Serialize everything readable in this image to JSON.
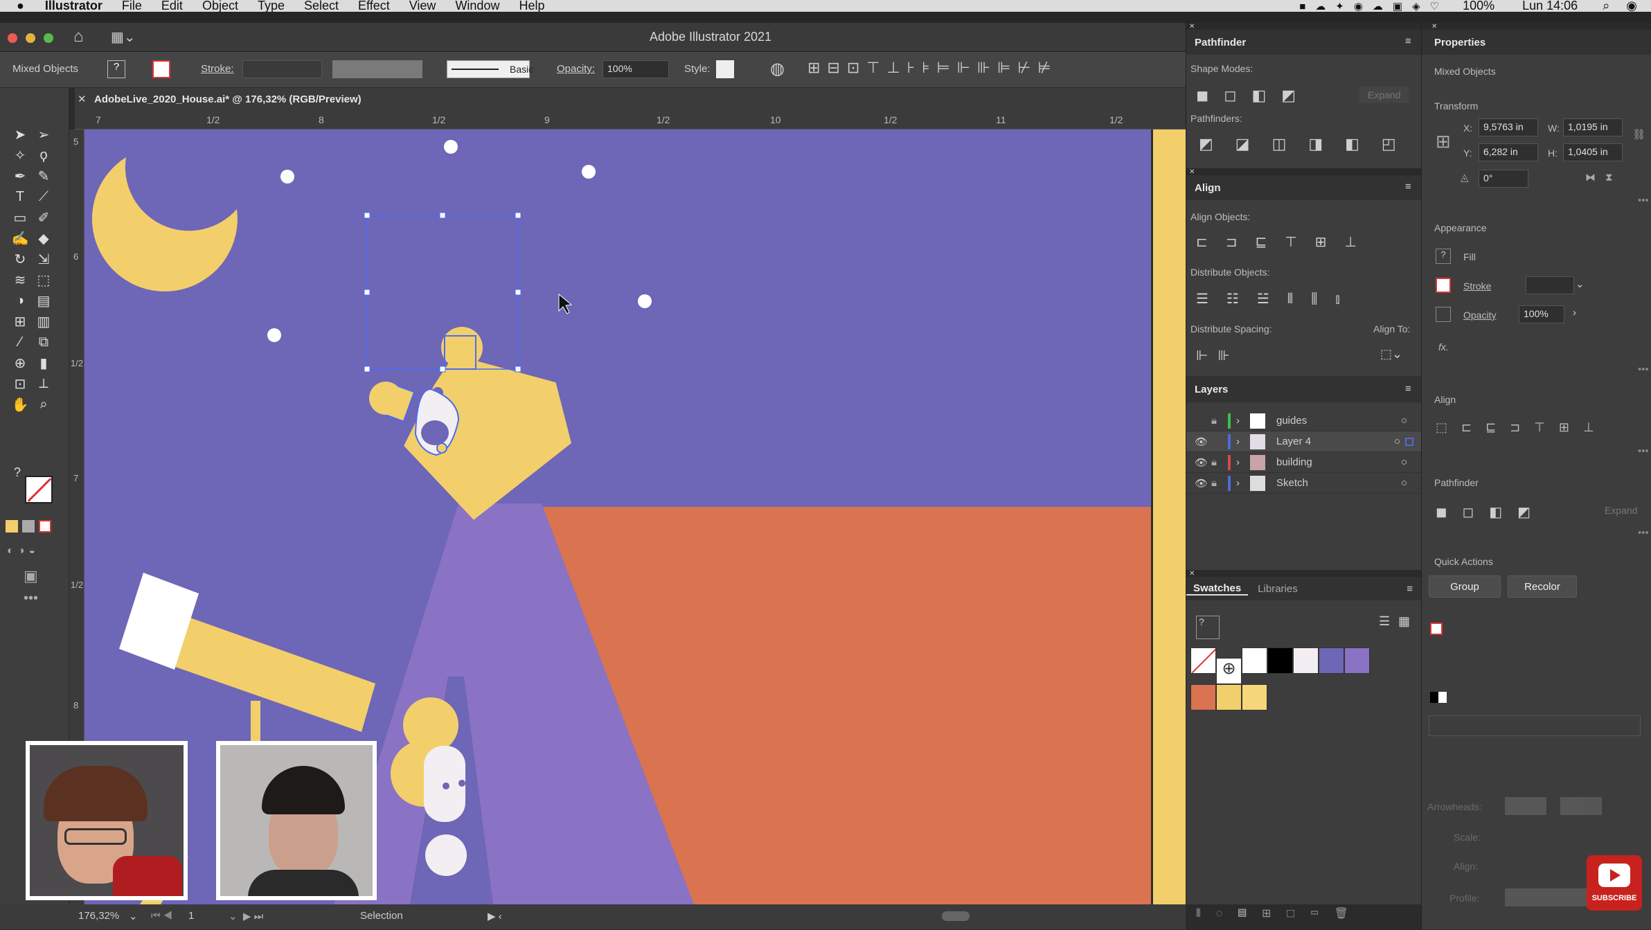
{
  "macos_menu": {
    "app_name": "Illustrator",
    "items": [
      "File",
      "Edit",
      "Object",
      "Type",
      "Select",
      "Effect",
      "View",
      "Window",
      "Help"
    ],
    "battery": "100%",
    "clock": "Lun 14:06"
  },
  "window": {
    "title": "Adobe Illustrator 2021"
  },
  "control_bar": {
    "selection_label": "Mixed Objects",
    "stroke_label": "Stroke:",
    "brush_label": "Basic",
    "opacity_label": "Opacity:",
    "opacity_value": "100%",
    "style_label": "Style:"
  },
  "document_tab": {
    "label": "AdobeLive_2020_House.ai* @ 176,32% (RGB/Preview)"
  },
  "rulers": {
    "h_ticks": [
      "7",
      "1/2",
      "8",
      "1/2",
      "9",
      "1/2",
      "10",
      "1/2",
      "11",
      "1/2"
    ],
    "v_ticks": [
      "5",
      "6",
      "1/2",
      "7",
      "1/2",
      "8"
    ]
  },
  "status_bar": {
    "zoom": "176,32%",
    "artboard": "1",
    "tool": "Selection"
  },
  "pathfinder_panel": {
    "title": "Pathfinder",
    "shape_modes": "Shape Modes:",
    "expand": "Expand",
    "pathfinders": "Pathfinders:"
  },
  "align_panel": {
    "title": "Align",
    "align_objects": "Align Objects:",
    "distribute_objects": "Distribute Objects:",
    "distribute_spacing": "Distribute Spacing:",
    "align_to": "Align To:"
  },
  "layers_panel": {
    "title": "Layers",
    "layers": [
      {
        "name": "guides",
        "color": "#3fbf4f",
        "visible": false,
        "locked": true
      },
      {
        "name": "Layer 4",
        "color": "#4b6bd8",
        "visible": true,
        "locked": false
      },
      {
        "name": "building",
        "color": "#d94848",
        "visible": true,
        "locked": true
      },
      {
        "name": "Sketch",
        "color": "#4b6bd8",
        "visible": true,
        "locked": true
      }
    ]
  },
  "swatches_panel": {
    "tab_swatches": "Swatches",
    "tab_libraries": "Libraries",
    "colors": [
      "none",
      "registration",
      "#ffffff",
      "#000000",
      "#f3eef2",
      "#6e66b6",
      "#8a72c4",
      "#d97350",
      "#f2cf6b",
      "#f5d67a"
    ]
  },
  "properties_panel": {
    "title": "Properties",
    "selection": "Mixed Objects",
    "transform_label": "Transform",
    "x_label": "X:",
    "x_value": "9,5763 in",
    "y_label": "Y:",
    "y_value": "6,282 in",
    "w_label": "W:",
    "w_value": "1,0195 in",
    "h_label": "H:",
    "h_value": "1,0405 in",
    "angle_value": "0°",
    "appearance_label": "Appearance",
    "fill_label": "Fill",
    "stroke_label": "Stroke",
    "opacity_label": "Opacity",
    "opacity_value": "100%",
    "fx_label": "fx.",
    "align_label": "Align",
    "pathfinder_label": "Pathfinder",
    "expand_label": "Expand",
    "quick_actions_label": "Quick Actions",
    "group_button": "Group",
    "recolor_button": "Recolor",
    "arrowheads_label": "Arrowheads:",
    "scale_label": "Scale:",
    "align_sub_label": "Align:",
    "profile_label": "Profile:"
  },
  "youtube": {
    "subscribe": "SUBSCRIBE"
  },
  "colors": {
    "canvas_bg": "#6e66b6",
    "moon": "#f2cf6b",
    "house_orange": "#d97350",
    "roof_purple": "#8a72c4",
    "selection_blue": "#4a6cf0"
  }
}
